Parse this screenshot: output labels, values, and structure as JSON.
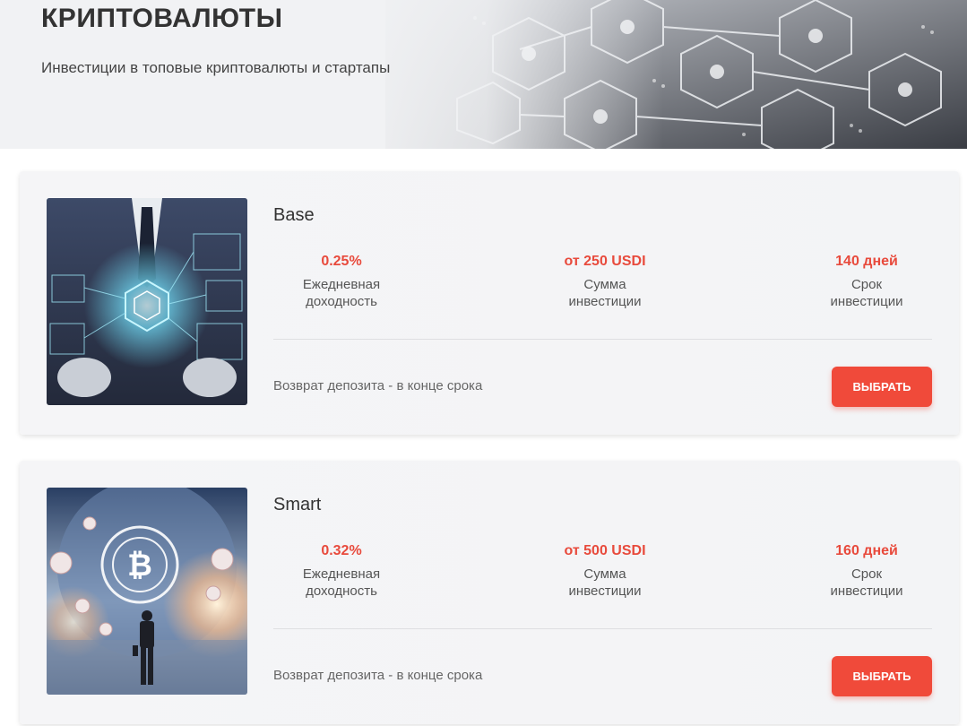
{
  "hero": {
    "title": "КРИПТОВАЛЮТЫ",
    "subtitle": "Инвестиции в топовые криптовалюты и стартапы"
  },
  "accent_color": "#f04a3a",
  "plans": [
    {
      "name": "Base",
      "image": "businessman-hologram-image",
      "stats": [
        {
          "value": "0.25%",
          "label_1": "Ежедневная",
          "label_2": "доходность"
        },
        {
          "value": "от 250 USDI",
          "label_1": "Сумма",
          "label_2": "инвестиции"
        },
        {
          "value": "140 дней",
          "label_1": "Срок",
          "label_2": "инвестиции"
        }
      ],
      "deposit_note": "Возврат депозита - в конце срока",
      "button_label": "ВЫБРАТЬ"
    },
    {
      "name": "Smart",
      "image": "bitcoin-globe-image",
      "stats": [
        {
          "value": "0.32%",
          "label_1": "Ежедневная",
          "label_2": "доходность"
        },
        {
          "value": "от 500 USDI",
          "label_1": "Сумма",
          "label_2": "инвестиции"
        },
        {
          "value": "160 дней",
          "label_1": "Срок",
          "label_2": "инвестиции"
        }
      ],
      "deposit_note": "Возврат депозита - в конце срока",
      "button_label": "ВЫБРАТЬ"
    }
  ]
}
